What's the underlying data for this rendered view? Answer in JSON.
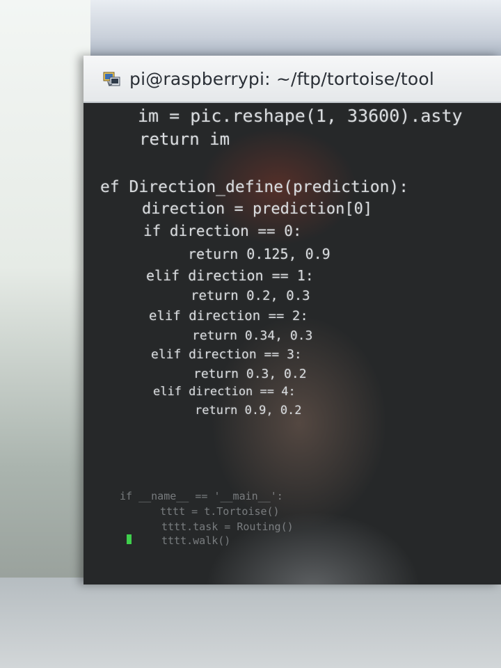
{
  "window": {
    "title": "pi@raspberrypi: ~/ftp/tortoise/tool",
    "icon": "terminal-app-icon"
  },
  "code_lines": [
    "im = pic.reshape(1, 33600).asty",
    "return im",
    "ef Direction_define(prediction):",
    "direction = prediction[0]",
    "if direction == 0:",
    "return 0.125, 0.9",
    "elif direction == 1:",
    "return 0.2, 0.3",
    "elif direction == 2:",
    "return 0.34, 0.3",
    "elif direction == 3:",
    "return 0.3, 0.2",
    "elif direction == 4:",
    "return 0.9, 0.2",
    "if __name__ == '__main__':",
    "tttt = t.Tortoise()",
    "tttt.task = Routing()",
    "tttt.walk()"
  ],
  "colors": {
    "terminal_bg": "#262829",
    "text": "#d9dcdf",
    "cursor": "#3fcf4c",
    "titlebar": "#f0f2f4"
  }
}
